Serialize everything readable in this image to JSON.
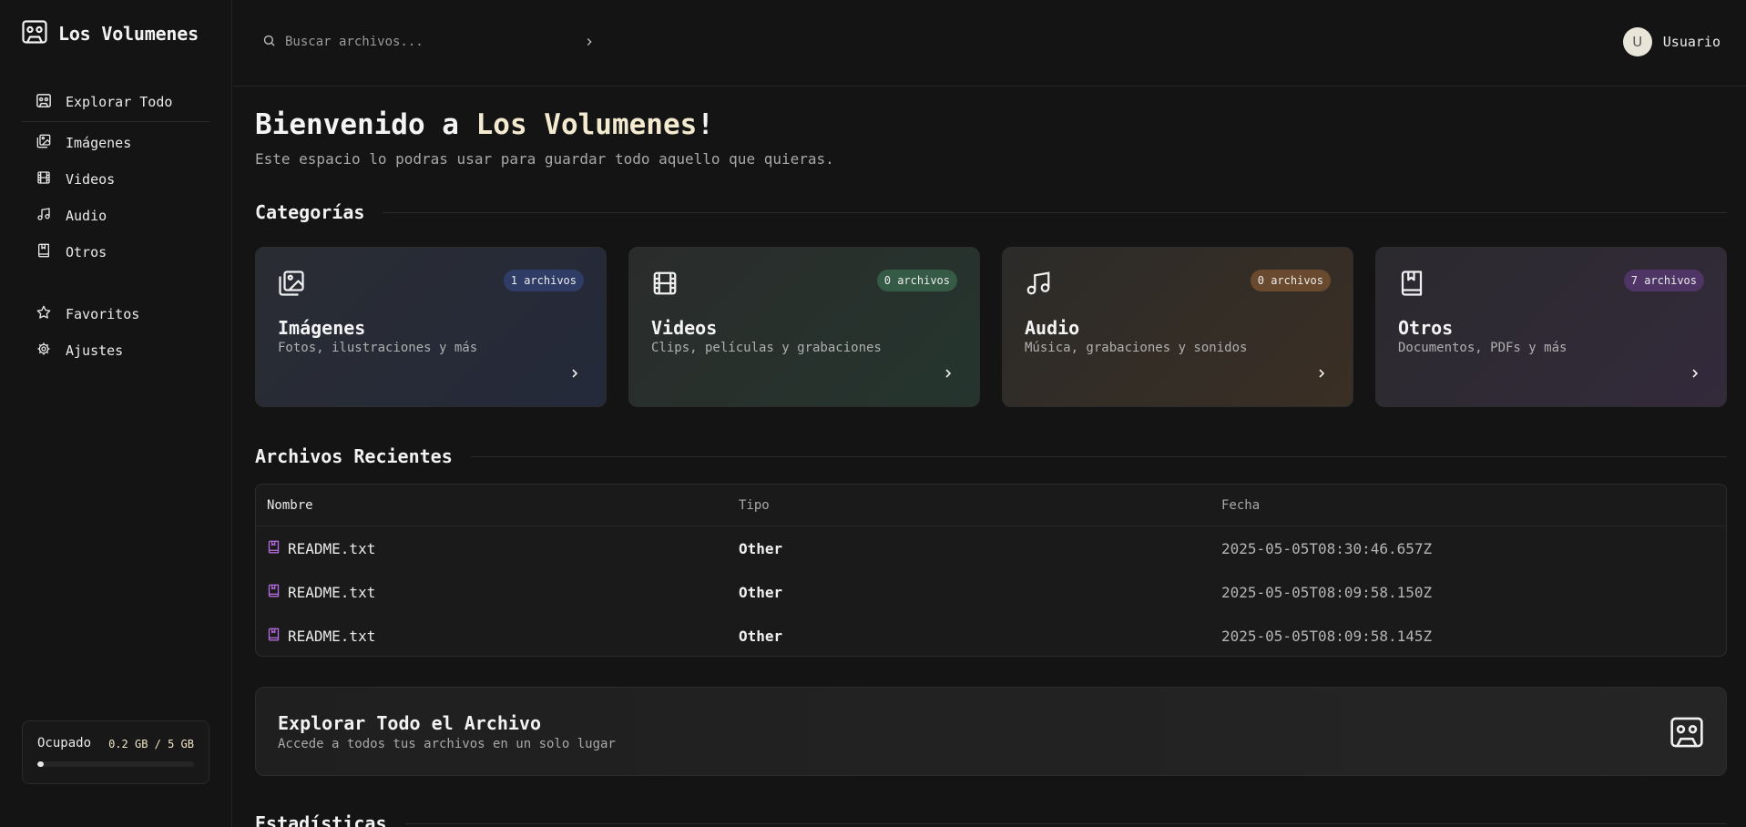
{
  "brand": {
    "title": "Los Volumenes"
  },
  "search": {
    "placeholder": "Buscar archivos..."
  },
  "user": {
    "avatar_initial": "U",
    "name": "Usuario"
  },
  "sidebar": {
    "items": [
      {
        "label": "Explorar Todo",
        "icon": "cassette-icon"
      },
      {
        "label": "Imágenes",
        "icon": "images-icon"
      },
      {
        "label": "Videos",
        "icon": "film-icon"
      },
      {
        "label": "Audio",
        "icon": "music-icon"
      },
      {
        "label": "Otros",
        "icon": "book-icon"
      },
      {
        "label": "Favoritos",
        "icon": "star-icon"
      },
      {
        "label": "Ajustes",
        "icon": "gear-icon"
      }
    ],
    "storage": {
      "label": "Ocupado",
      "value": "0.2 GB / 5 GB",
      "fraction": 0.04
    }
  },
  "main": {
    "welcome_prefix": "Bienvenido a ",
    "welcome_accent": "Los Volumenes",
    "welcome_suffix": "!",
    "subtitle": "Este espacio lo podras usar para guardar todo aquello que quieras.",
    "categories_title": "Categorías",
    "categories": [
      {
        "title": "Imágenes",
        "desc": "Fotos, ilustraciones y más",
        "badge": "1 archivos",
        "icon": "images-icon",
        "badge_color": "#2f3d66"
      },
      {
        "title": "Videos",
        "desc": "Clips, películas y grabaciones",
        "badge": "0 archivos",
        "icon": "film-icon",
        "badge_color": "#355a45"
      },
      {
        "title": "Audio",
        "desc": "Música, grabaciones y sonidos",
        "badge": "0 archivos",
        "icon": "music-icon",
        "badge_color": "#6a4a2e"
      },
      {
        "title": "Otros",
        "desc": "Documentos, PDFs y más",
        "badge": "7 archivos",
        "icon": "book-icon",
        "badge_color": "#4f3566"
      }
    ],
    "recent_title": "Archivos Recientes",
    "table": {
      "headers": [
        "Nombre",
        "Tipo",
        "Fecha"
      ],
      "rows": [
        {
          "name": "README.txt",
          "type": "Other",
          "date": "2025-05-05T08:30:46.657Z"
        },
        {
          "name": "README.txt",
          "type": "Other",
          "date": "2025-05-05T08:09:58.150Z"
        },
        {
          "name": "README.txt",
          "type": "Other",
          "date": "2025-05-05T08:09:58.145Z"
        }
      ]
    },
    "explore": {
      "title": "Explorar Todo el Archivo",
      "desc": "Accede a todos tus archivos en un solo lugar"
    },
    "stats_title": "Estadísticas"
  },
  "colors": {
    "accent_text": "#f3ead0",
    "file_icon": "#b06ad8",
    "background": "#141414"
  }
}
